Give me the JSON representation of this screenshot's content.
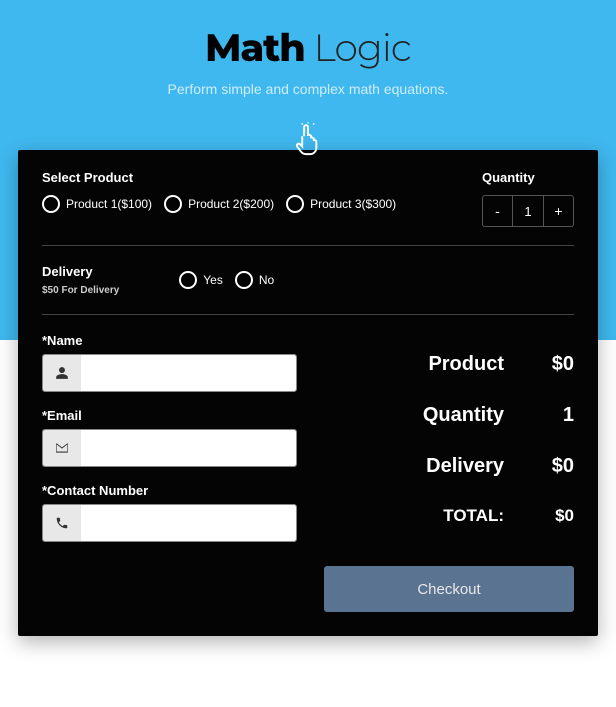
{
  "header": {
    "title_bold": "Math",
    "title_light": " Logic",
    "subtitle": "Perform simple and complex math equations."
  },
  "product": {
    "label": "Select Product",
    "options": [
      {
        "label": "Product 1($100)"
      },
      {
        "label": "Product 2($200)"
      },
      {
        "label": "Product 3($300)"
      }
    ]
  },
  "quantity": {
    "label": "Quantity",
    "minus": "-",
    "plus": "+",
    "value": "1"
  },
  "delivery": {
    "label": "Delivery",
    "sub": "$50 For Delivery",
    "yes": "Yes",
    "no": "No"
  },
  "form": {
    "name_label": "*Name",
    "email_label": "*Email",
    "contact_label": "*Contact Number"
  },
  "summary": {
    "product_label": "Product",
    "product_val": "$0",
    "quantity_label": "Quantity",
    "quantity_val": "1",
    "delivery_label": "Delivery",
    "delivery_val": "$0",
    "total_label": "TOTAL:",
    "total_val": "$0"
  },
  "checkout": "Checkout"
}
